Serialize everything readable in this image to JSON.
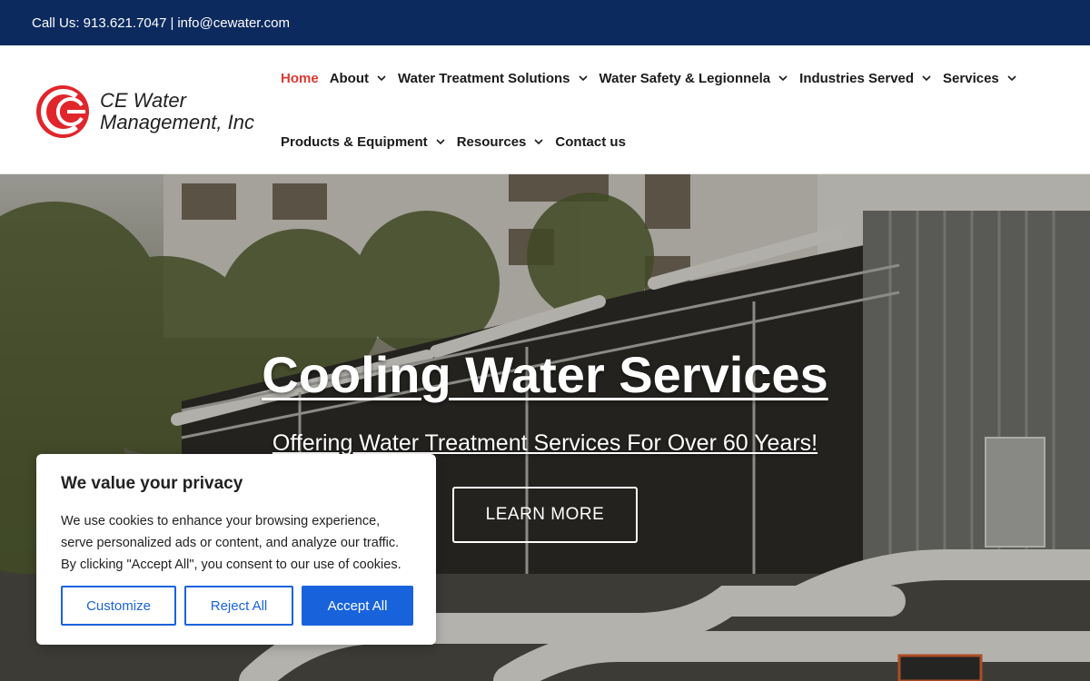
{
  "topbar": {
    "call_label": "Call Us: 913.621.7047",
    "separator": "|",
    "email": "info@cewater.com"
  },
  "logo": {
    "line1": "CE Water",
    "line2": "Management, Inc",
    "brand_color": "#e0262b"
  },
  "nav": {
    "row1": [
      {
        "label": "Home",
        "active": true,
        "dropdown": false
      },
      {
        "label": "About",
        "dropdown": true
      },
      {
        "label": "Water Treatment Solutions",
        "dropdown": true
      },
      {
        "label": "Water Safety & Legionnela",
        "dropdown": true
      },
      {
        "label": "Industries Served",
        "dropdown": true
      },
      {
        "label": "Services",
        "dropdown": true
      }
    ],
    "row2": [
      {
        "label": "Products & Equipment",
        "dropdown": true
      },
      {
        "label": "Resources",
        "dropdown": true
      },
      {
        "label": "Contact us",
        "dropdown": false
      }
    ],
    "active_color": "#d93a31"
  },
  "hero": {
    "title": "Cooling Water Services",
    "subtitle": "Offering Water Treatment Services For Over 60 Years!",
    "button_label": "LEARN MORE"
  },
  "cookie": {
    "title": "We value your privacy",
    "body": "We use cookies to enhance your browsing experience, serve personalized ads or content, and analyze our traffic. By clicking \"Accept All\", you consent to our use of cookies.",
    "customize_label": "Customize",
    "reject_label": "Reject All",
    "accept_label": "Accept All",
    "accent_color": "#1863dc"
  },
  "colors": {
    "topbar_bg": "#0c2a5e"
  }
}
